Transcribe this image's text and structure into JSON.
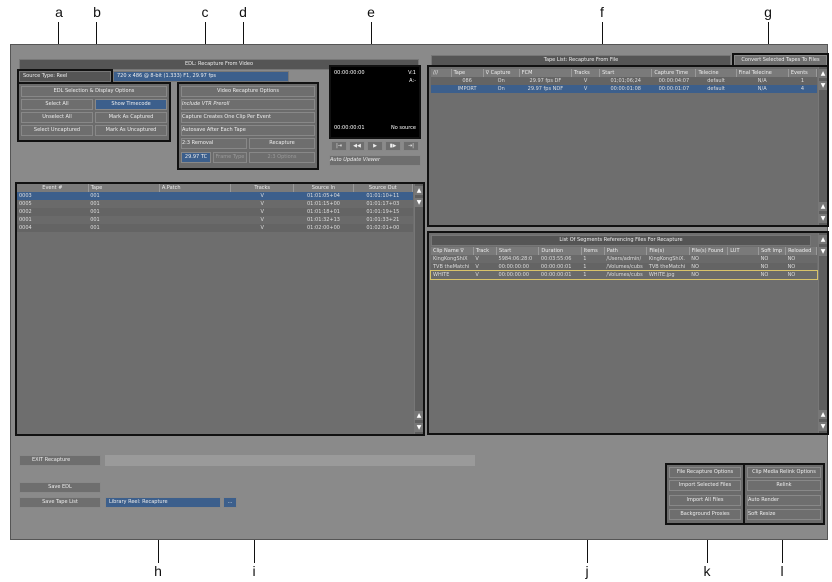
{
  "callouts": {
    "a": "a",
    "b": "b",
    "c": "c",
    "d": "d",
    "e": "e",
    "f": "f",
    "g": "g",
    "h": "h",
    "i": "i",
    "j": "j",
    "k": "k",
    "l": "l"
  },
  "edl": {
    "title": "EDL: Recapture From Video",
    "source_type": "Source Type: Reel",
    "format": "720 x 486 @ 8-bit (1.333) F1, 29.97 fps"
  },
  "selection": {
    "header": "EDL Selection & Display Options",
    "select_all": "Select All",
    "show_timecode": "Show Timecode",
    "unselect_all": "Unselect All",
    "mark_captured": "Mark As Captured",
    "select_uncaptured": "Select Uncaptured",
    "mark_uncaptured": "Mark As Uncaptured"
  },
  "video_options": {
    "header": "Video Recapture Options",
    "include_vtr": "Include VTR Preroll",
    "one_clip": "Capture Creates One Clip Per Event",
    "autosave": "Autosave After Each Tape",
    "removal": "2:3 Removal",
    "recapture": "Recapture",
    "tc": "29.97 TC",
    "frame_type": "Frame Type",
    "options": "2:3 Options"
  },
  "viewer": {
    "tc_top": "00:00:00:00",
    "v1": "V:1",
    "a": "A:-",
    "tc_bottom": "00:00:00:01",
    "no_source": "No source",
    "auto_update": "Auto Update Viewer",
    "transport": [
      "|⇥",
      "◀◀",
      "▶",
      "▮▶",
      "⇥|"
    ]
  },
  "event_table": {
    "headers": [
      "Event #",
      "Tape",
      "A.Patch",
      "Tracks",
      "Source In",
      "Source Out"
    ],
    "rows": [
      [
        "0003",
        "001",
        "",
        "V",
        "01:01:05+04",
        "01:01:10+11"
      ],
      [
        "0005",
        "001",
        "",
        "V",
        "01:01:15+00",
        "01:01:17+03"
      ],
      [
        "0002",
        "001",
        "",
        "V",
        "01:01:18+01",
        "01:01:19+15"
      ],
      [
        "0001",
        "001",
        "",
        "V",
        "01:01:32+13",
        "01:01:33+21"
      ],
      [
        "0004",
        "001",
        "",
        "V",
        "01:02:00+00",
        "01:02:01+00"
      ]
    ]
  },
  "tape_list": {
    "title": "Tape List: Recapture From File",
    "convert": "Convert Selected Tapes To Files",
    "headers": [
      "///",
      "Tape",
      "∇ Capture",
      "FCM",
      "Tracks",
      "Start",
      "Capture Time",
      "Telecine",
      "Final Telecine",
      "Events"
    ],
    "rows": [
      [
        "",
        "086",
        "On",
        "29.97 fps DF",
        "V",
        "01;01;06;24",
        "00:00:04:07",
        "default",
        "N/A",
        "1"
      ],
      [
        "",
        "IMPORT",
        "On",
        "29.97 fps NDF",
        "V",
        "00:00:01:08",
        "00:00:01:07",
        "default",
        "N/A",
        "4"
      ]
    ]
  },
  "segments": {
    "title": "List Of Segments Referencing Files For Recapture",
    "headers": [
      "Clip Name ∇",
      "Track",
      "Start",
      "Duration",
      "Items",
      "Path",
      "File(s)",
      "File(s) Found",
      "LUT",
      "Soft Imp",
      "Reloaded"
    ],
    "rows": [
      [
        "KingKongShiX",
        "V",
        "5984:06:28:0",
        "00:03:55:06",
        "1",
        "/Users/admin/",
        "KingKongShiX.",
        "NO",
        "",
        "NO",
        "NO"
      ],
      [
        "TVB theMatchi",
        "V",
        "00:00:00:00",
        "00:00:00:01",
        "1",
        "/Volumes/cubs",
        "TVB theMatchi",
        "NO",
        "",
        "NO",
        "NO"
      ],
      [
        "WHITE",
        "V",
        "00:00:00:00",
        "00:00:00:01",
        "1",
        "/Volumes/cubs",
        "WHITE.jpg",
        "NO",
        "",
        "NO",
        "NO"
      ]
    ]
  },
  "bottom": {
    "exit": "EXIT Recapture",
    "save_edl": "Save EDL",
    "save_tape": "Save Tape List",
    "library_reel": "Library Reel: Recapture",
    "browse": "..."
  },
  "file_opts": {
    "file_recapture": "File Recapture Options",
    "import_selected": "Import Selected Files",
    "import_all": "Import All Files",
    "background": "Background Proxies"
  },
  "relink": {
    "clip_media": "Clip Media Relink Options",
    "relink": "Relink",
    "auto_render": "Auto Render",
    "soft_resize": "Soft Resize"
  },
  "colors": {
    "selected_blue": "#3c5f8c",
    "panel": "#6b6b6b",
    "background": "#8a8a8a"
  },
  "icons": {
    "up": "up-arrow-icon",
    "down": "down-arrow-icon"
  }
}
